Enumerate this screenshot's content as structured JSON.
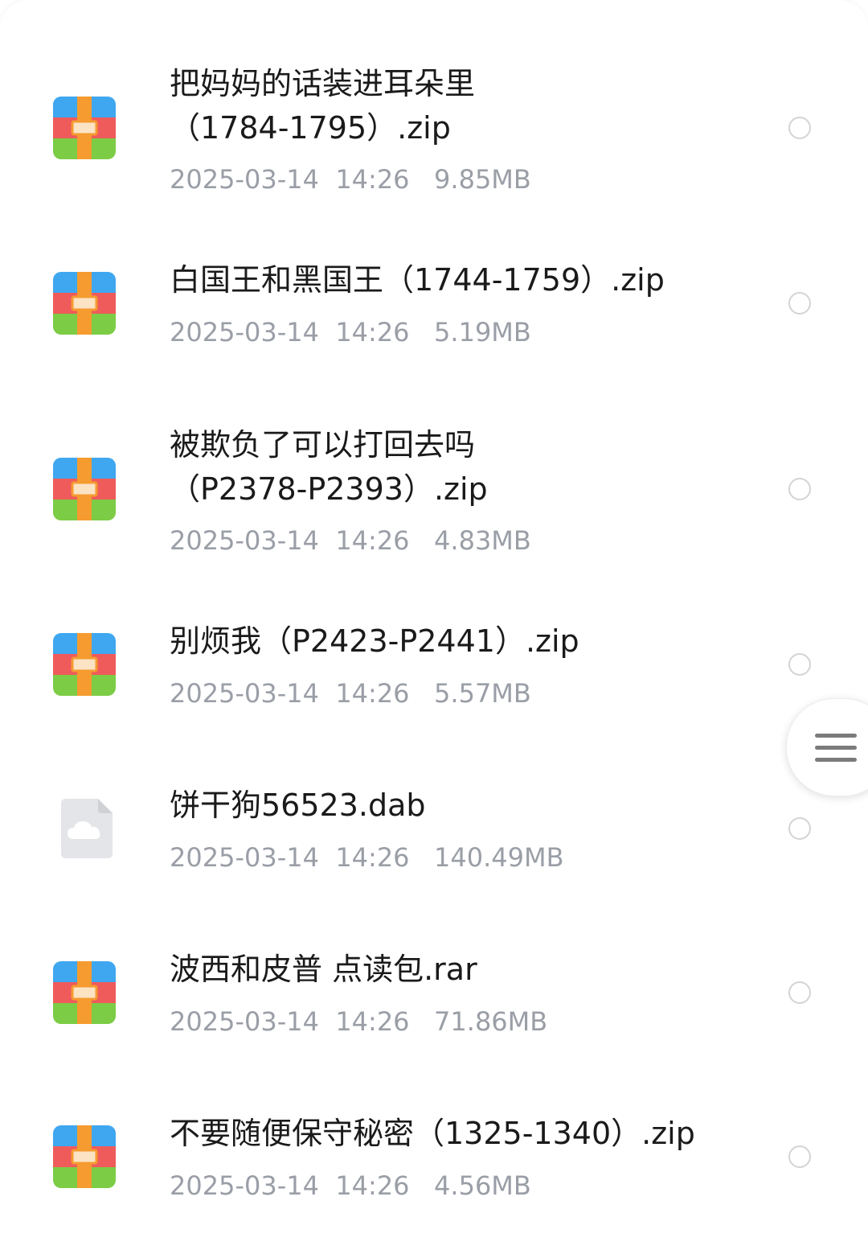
{
  "files": [
    {
      "name": "把妈妈的话装进耳朵里\n（1784-1795）.zip",
      "meta": "2025-03-14  14:26   9.85MB",
      "icon": "zip-archive-icon"
    },
    {
      "name": "白国王和黑国王（1744-1759）.zip",
      "meta": "2025-03-14  14:26   5.19MB",
      "icon": "zip-archive-icon"
    },
    {
      "name": "被欺负了可以打回去吗\n（P2378-P2393）.zip",
      "meta": "2025-03-14  14:26   4.83MB",
      "icon": "zip-archive-icon"
    },
    {
      "name": "别烦我（P2423-P2441）.zip",
      "meta": "2025-03-14  14:26   5.57MB",
      "icon": "zip-archive-icon"
    },
    {
      "name": "饼干狗56523.dab",
      "meta": "2025-03-14  14:26   140.49MB",
      "icon": "cloud-file-icon"
    },
    {
      "name": "波西和皮普 点读包.rar",
      "meta": "2025-03-14  14:26   71.86MB",
      "icon": "zip-archive-icon"
    },
    {
      "name": "不要随便保守秘密（1325-1340）.zip",
      "meta": "2025-03-14  14:26   4.56MB",
      "icon": "zip-archive-icon"
    }
  ],
  "colors": {
    "archive_blue": "#3fa7f0",
    "archive_red": "#ef5b5b",
    "archive_green": "#7ccc45",
    "archive_orange": "#f59b2f",
    "meta_gray": "#9a9ea6"
  }
}
